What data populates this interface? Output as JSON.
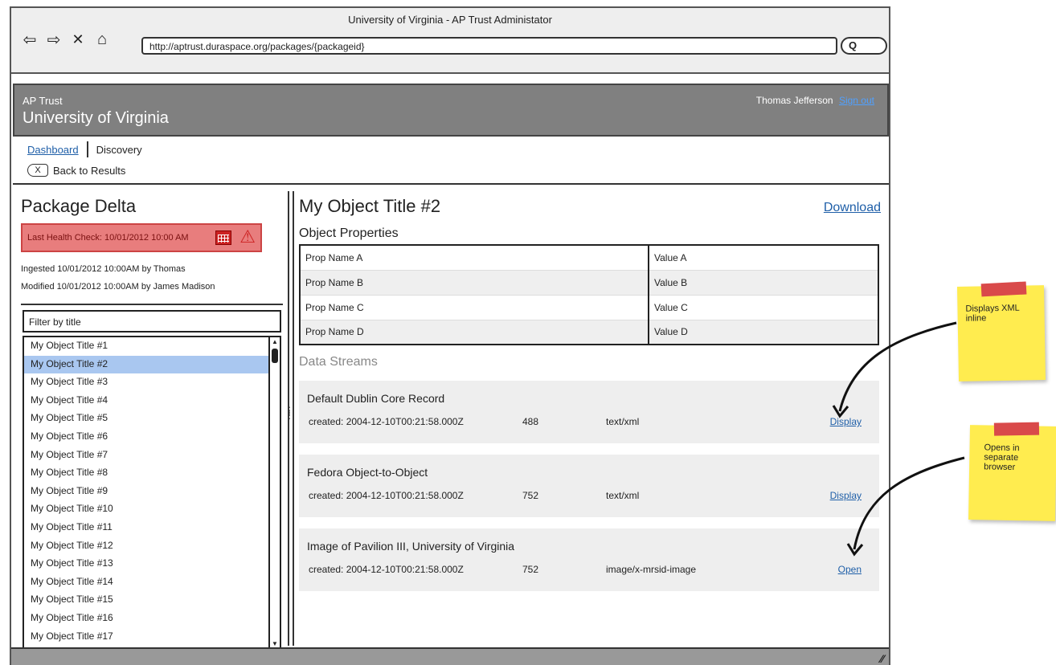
{
  "window": {
    "title": "University of Virginia - AP Trust Administator"
  },
  "browser": {
    "url": "http://aptrust.duraspace.org/packages/{packageid}",
    "search_glyph": "Q"
  },
  "header": {
    "org": "AP Trust",
    "institution": "University of Virginia",
    "user": "Thomas Jefferson",
    "signout": "Sign out"
  },
  "nav": {
    "dashboard": "Dashboard",
    "discovery": "Discovery",
    "back": "Back to Results",
    "back_glyph": "X"
  },
  "package": {
    "title": "Package Delta",
    "health": "Last Health Check: 10/01/2012  10:00 AM",
    "ingested": "Ingested  10/01/2012 10:00AM by Thomas",
    "modified": "Modified  10/01/2012 10:00AM by James Madison",
    "filter_placeholder": "Filter by title",
    "items": [
      "My Object Title #1",
      "My Object Title #2",
      "My Object Title #3",
      "My Object Title #4",
      "My Object Title #5",
      "My Object Title #6",
      "My Object Title #7",
      "My Object Title #8",
      "My Object Title #9",
      "My Object Title #10",
      "My Object Title #11",
      "My Object Title #12",
      "My Object Title #13",
      "My Object Title #14",
      "My Object Title #15",
      "My Object Title #16",
      "My Object Title #17"
    ],
    "selected_index": 1
  },
  "object": {
    "title": "My Object Title #2",
    "download": "Download",
    "props_heading": "Object Properties",
    "props": [
      {
        "name": "Prop Name A",
        "value": "Value A"
      },
      {
        "name": "Prop Name B",
        "value": "Value B"
      },
      {
        "name": "Prop Name C",
        "value": "Value C"
      },
      {
        "name": "Prop Name D",
        "value": "Value D"
      }
    ],
    "streams_heading": "Data Streams",
    "streams": [
      {
        "name": "Default Dublin Core Record",
        "created": "created: 2004-12-10T00:21:58.000Z",
        "size": "488",
        "mime": "text/xml",
        "action": "Display"
      },
      {
        "name": "Fedora Object-to-Object",
        "created": "created: 2004-12-10T00:21:58.000Z",
        "size": "752",
        "mime": "text/xml",
        "action": "Display"
      },
      {
        "name": "Image of Pavilion III, University of Virginia",
        "created": "created: 2004-12-10T00:21:58.000Z",
        "size": "752",
        "mime": "image/x-mrsid-image",
        "action": "Open"
      }
    ]
  },
  "notes": {
    "note1": "Displays XML inline",
    "note2": "Opens in separate browser"
  }
}
